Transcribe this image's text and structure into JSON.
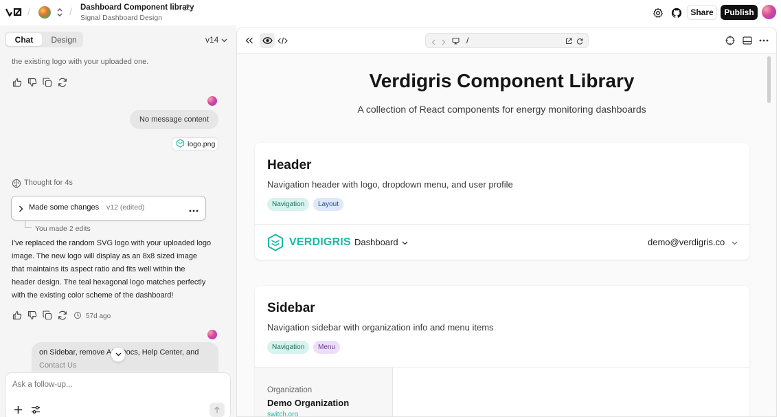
{
  "topbar": {
    "project_title": "Dashboard Component library",
    "project_subtitle": "Signal Dashboard Design",
    "share_label": "Share",
    "publish_label": "Publish"
  },
  "left_panel": {
    "tabs": [
      {
        "label": "Chat"
      },
      {
        "label": "Design"
      }
    ],
    "version": "v14",
    "messages": {
      "prev_tail": "the existing logo with your uploaded one.",
      "user_bubble": "No message content",
      "attachment": "logo.png",
      "thought": "Thought for 4s",
      "changes_title": "Made some changes",
      "changes_version": "v12 (edited)",
      "edits_note": "You made 2 edits",
      "assistant_lines": [
        "I've replaced the random SVG logo with your uploaded logo",
        "image. The new logo will display as an 8x8 sized image",
        "that maintains its aspect ratio and fits well within the",
        "header design. The teal hexagonal logo matches perfectly",
        "with the existing color scheme of the dashboard!"
      ],
      "timestamp": "57d ago",
      "user_bubble2_line1": "on Sidebar, remove API Docs, Help Center, and",
      "user_bubble2_line2": "Contact Us"
    },
    "composer_placeholder": "Ask a follow-up..."
  },
  "preview": {
    "url": "/",
    "page_title": "Verdigris Component Library",
    "page_subtitle": "A collection of React components for energy monitoring dashboards",
    "cards": [
      {
        "title": "Header",
        "description": "Navigation header with logo, dropdown menu, and user profile",
        "tags": [
          "Navigation",
          "Layout"
        ],
        "demo": {
          "brand": "VERDIGRIS",
          "menu": "Dashboard",
          "user": "demo@verdigris.co"
        }
      },
      {
        "title": "Sidebar",
        "description": "Navigation sidebar with organization info and menu items",
        "tags": [
          "Navigation",
          "Menu"
        ],
        "demo": {
          "org_label": "Organization",
          "org_name": "Demo Organization",
          "org_link": "switch.org"
        }
      }
    ]
  },
  "colors": {
    "brand_teal": "#1fb7a6",
    "publish_bg": "#111111",
    "panel_bg": "#f5f5f5"
  }
}
